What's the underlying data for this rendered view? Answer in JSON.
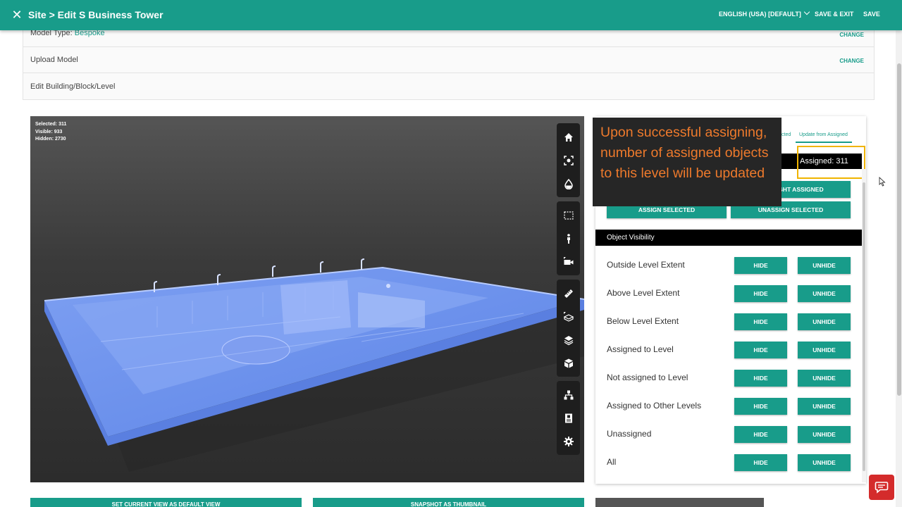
{
  "header": {
    "title": "Site > Edit S Business Tower",
    "language": "ENGLISH (USA) [DEFAULT]",
    "save_exit": "SAVE & EXIT",
    "save": "SAVE"
  },
  "settings": {
    "model_type_label": "Model Type: ",
    "model_type_value": "Bespoke",
    "upload_model": "Upload Model",
    "edit_level": "Edit Building/Block/Level",
    "change": "CHANGE"
  },
  "viewer": {
    "stats": [
      "Selected: 311",
      "Visible: 933",
      "Hidden: 2730"
    ],
    "toolbar_groups": [
      [
        "home-icon",
        "fit-view-icon",
        "model-browser-icon"
      ],
      [
        "section-box-icon",
        "first-person-icon",
        "camera-icon"
      ],
      [
        "measure-icon",
        "explode-icon",
        "layers-icon",
        "box-icon"
      ],
      [
        "structure-tree-icon",
        "properties-icon",
        "settings-icon"
      ]
    ]
  },
  "bottom_buttons": {
    "default_view": "SET CURRENT VIEW AS DEFAULT VIEW",
    "snapshot": "SNAPSHOT AS THUMBNAIL"
  },
  "panel": {
    "tabs": [
      "cted",
      "Update from Assigned"
    ],
    "assigned": "Assigned: 311",
    "highlight_assigned": "HIGHLIGHT ASSIGNED",
    "assign_selected": "ASSIGN SELECTED",
    "unassign_selected": "UNASSIGN SELECTED",
    "visibility_header": "Object Visibility",
    "hide": "HIDE",
    "unhide": "UNHIDE",
    "visibility_rows": [
      "Outside Level Extent",
      "Above Level Extent",
      "Below Level Extent",
      "Assigned to Level",
      "Not assigned to Level",
      "Assigned to Other Levels",
      "Unassigned",
      "All"
    ]
  },
  "callout": {
    "text": "Upon successful assigning, number of assigned objects to this level will be updated"
  },
  "colors": {
    "primary": "#189c8a",
    "callout_text": "#ee7a2c",
    "highlight": "#f0b400",
    "model": "#6f95f0"
  }
}
